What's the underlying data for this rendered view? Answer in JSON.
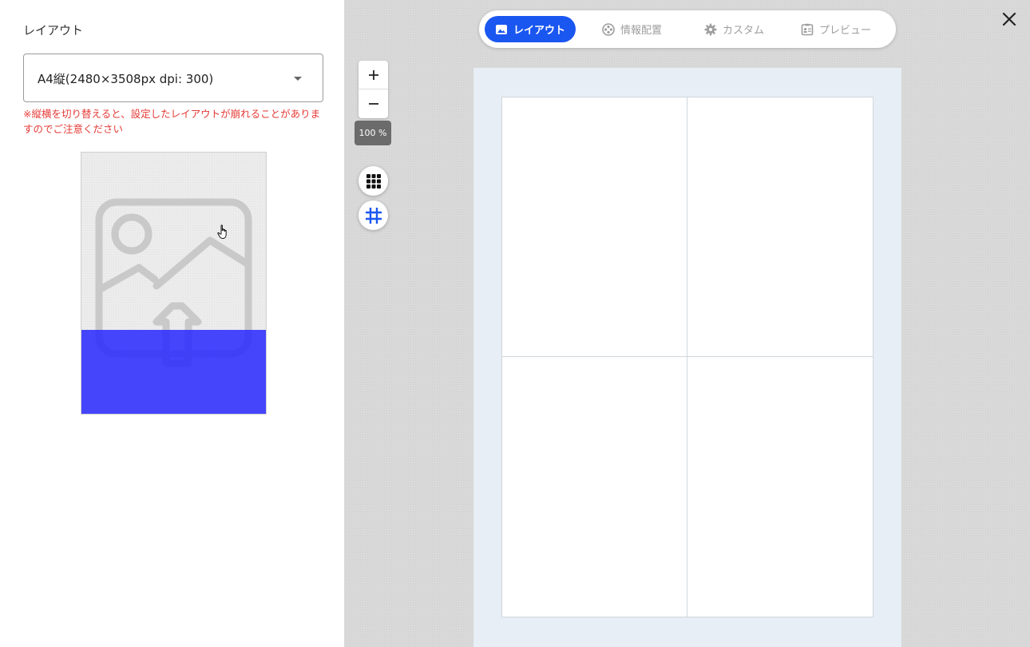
{
  "left_panel": {
    "title": "レイアウト",
    "size_select": {
      "value": "A4縦(2480×3508px dpi: 300)"
    },
    "warning": "※縦横を切り替えると、設定したレイアウトが崩れることがありますのでご注意ください",
    "upload": {
      "progress_fraction": 0.32,
      "progress_color": "#2828ff"
    }
  },
  "tabs": [
    {
      "label": "レイアウト",
      "icon": "image-icon",
      "active": true
    },
    {
      "label": "情報配置",
      "icon": "film-reel-icon",
      "active": false
    },
    {
      "label": "カスタム",
      "icon": "gear-icon",
      "active": false
    },
    {
      "label": "プレビュー",
      "icon": "id-card-icon",
      "active": false
    }
  ],
  "zoom": {
    "plus": "+",
    "minus": "−",
    "level": "100 %"
  },
  "tools": [
    {
      "icon": "dot-grid-icon"
    },
    {
      "icon": "hash-grid-icon",
      "color": "#1a56f0"
    }
  ],
  "canvas": {
    "rows": 2,
    "cols": 2
  },
  "colors": {
    "accent": "#1a56f0",
    "warning": "#e53935"
  }
}
